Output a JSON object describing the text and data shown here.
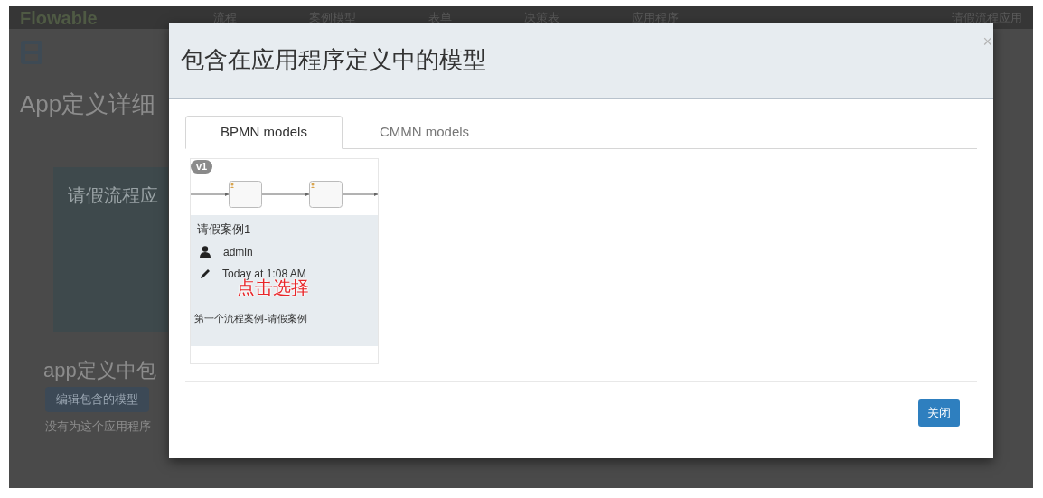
{
  "background": {
    "logo": "Flowable",
    "nav": [
      "流程",
      "案例模型",
      "表单",
      "决策表",
      "应用程序"
    ],
    "user": "请假流程应用",
    "heading": "App定义详细",
    "app_tile": "请假流程应",
    "section_heading": "app定义中包",
    "edit_button": "编辑包含的模型",
    "note": "没有为这个应用程序"
  },
  "modal": {
    "title": "包含在应用程序定义中的模型",
    "close_icon": "×",
    "tabs": [
      {
        "label": "BPMN models",
        "selected": true
      },
      {
        "label": "CMMN models",
        "selected": false
      }
    ],
    "models": [
      {
        "version": "v1",
        "name": "请假案例1",
        "owner": "admin",
        "modified": "Today at 1:08 AM",
        "description": "第一个流程案例-请假案例"
      }
    ],
    "annotation": "点击选择",
    "buttons": [
      "关闭"
    ]
  }
}
